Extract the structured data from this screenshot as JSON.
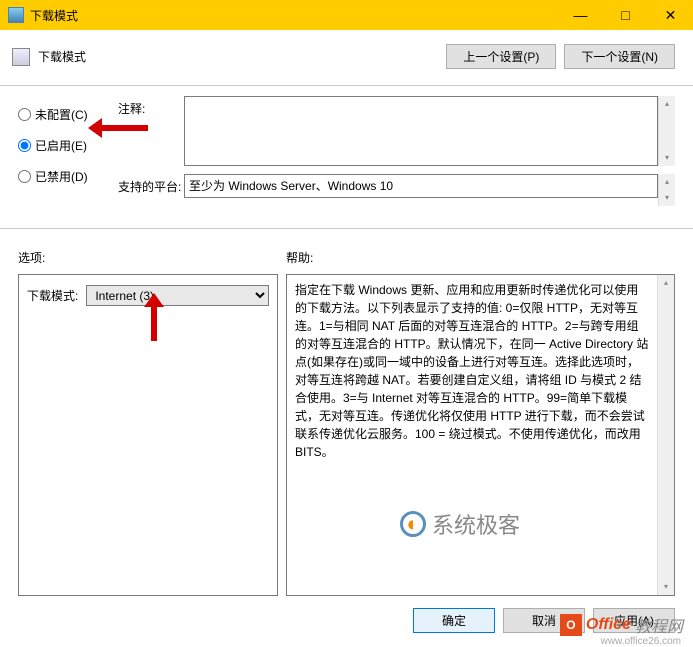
{
  "titlebar": {
    "title": "下载模式",
    "minimize": "—",
    "maximize": "□",
    "close": "✕"
  },
  "header": {
    "title": "下载模式",
    "prev_btn": "上一个设置(P)",
    "next_btn": "下一个设置(N)"
  },
  "radios": {
    "not_configured": "未配置(C)",
    "enabled": "已启用(E)",
    "disabled": "已禁用(D)"
  },
  "fields": {
    "comment_label": "注释:",
    "comment_value": "",
    "platform_label": "支持的平台:",
    "platform_value": "至少为 Windows Server、Windows 10"
  },
  "labels": {
    "options": "选项:",
    "help": "帮助:"
  },
  "options": {
    "mode_label": "下载模式:",
    "mode_value": "Internet (3)"
  },
  "help": {
    "text": "指定在下载 Windows 更新、应用和应用更新时传递优化可以使用的下载方法。以下列表显示了支持的值: 0=仅限 HTTP，无对等互连。1=与相同 NAT 后面的对等互连混合的 HTTP。2=与跨专用组的对等互连混合的 HTTP。默认情况下，在同一 Active Directory 站点(如果存在)或同一域中的设备上进行对等互连。选择此选项时，对等互连将跨越 NAT。若要创建自定义组，请将组 ID 与模式 2 结合使用。3=与 Internet 对等互连混合的 HTTP。99=简单下载模式，无对等互连。传递优化将仅使用 HTTP 进行下载，而不会尝试联系传递优化云服务。100 = 绕过模式。不使用传递优化，而改用 BITS。"
  },
  "footer": {
    "ok": "确定",
    "cancel": "取消",
    "apply": "应用(A)"
  },
  "watermark": {
    "wm1": "系统极客",
    "wm2a": "Office",
    "wm2b": "教程网",
    "wm2url": "www.office26.com"
  }
}
